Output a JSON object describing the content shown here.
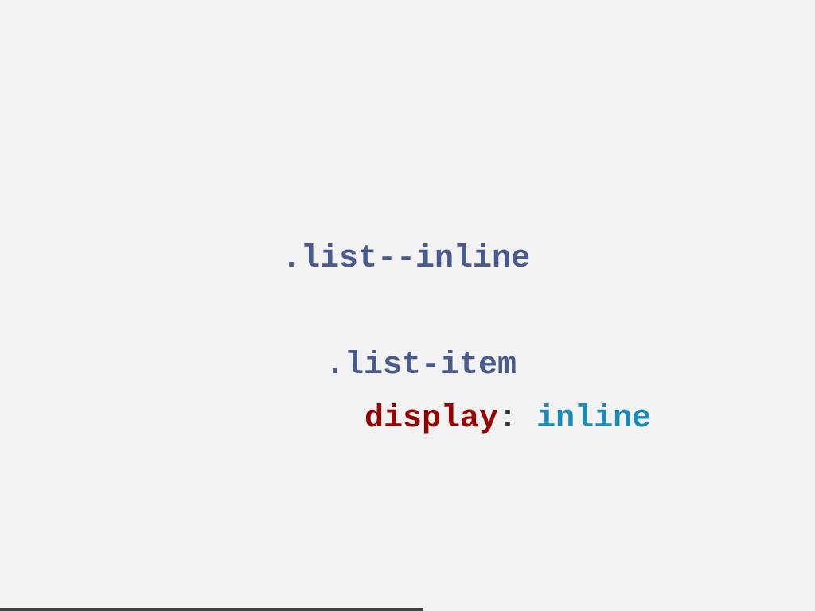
{
  "slide": {
    "outer_selector": ".list--inline",
    "inner_selector": ".list-item",
    "property": "display",
    "colon": ":",
    "value": "inline"
  },
  "colors": {
    "background": "#f2f2f2",
    "selector": "#4a5a8f",
    "property": "#990000",
    "value": "#1a8ab8",
    "progress": "#444444"
  },
  "progress": {
    "fraction": 0.52
  }
}
